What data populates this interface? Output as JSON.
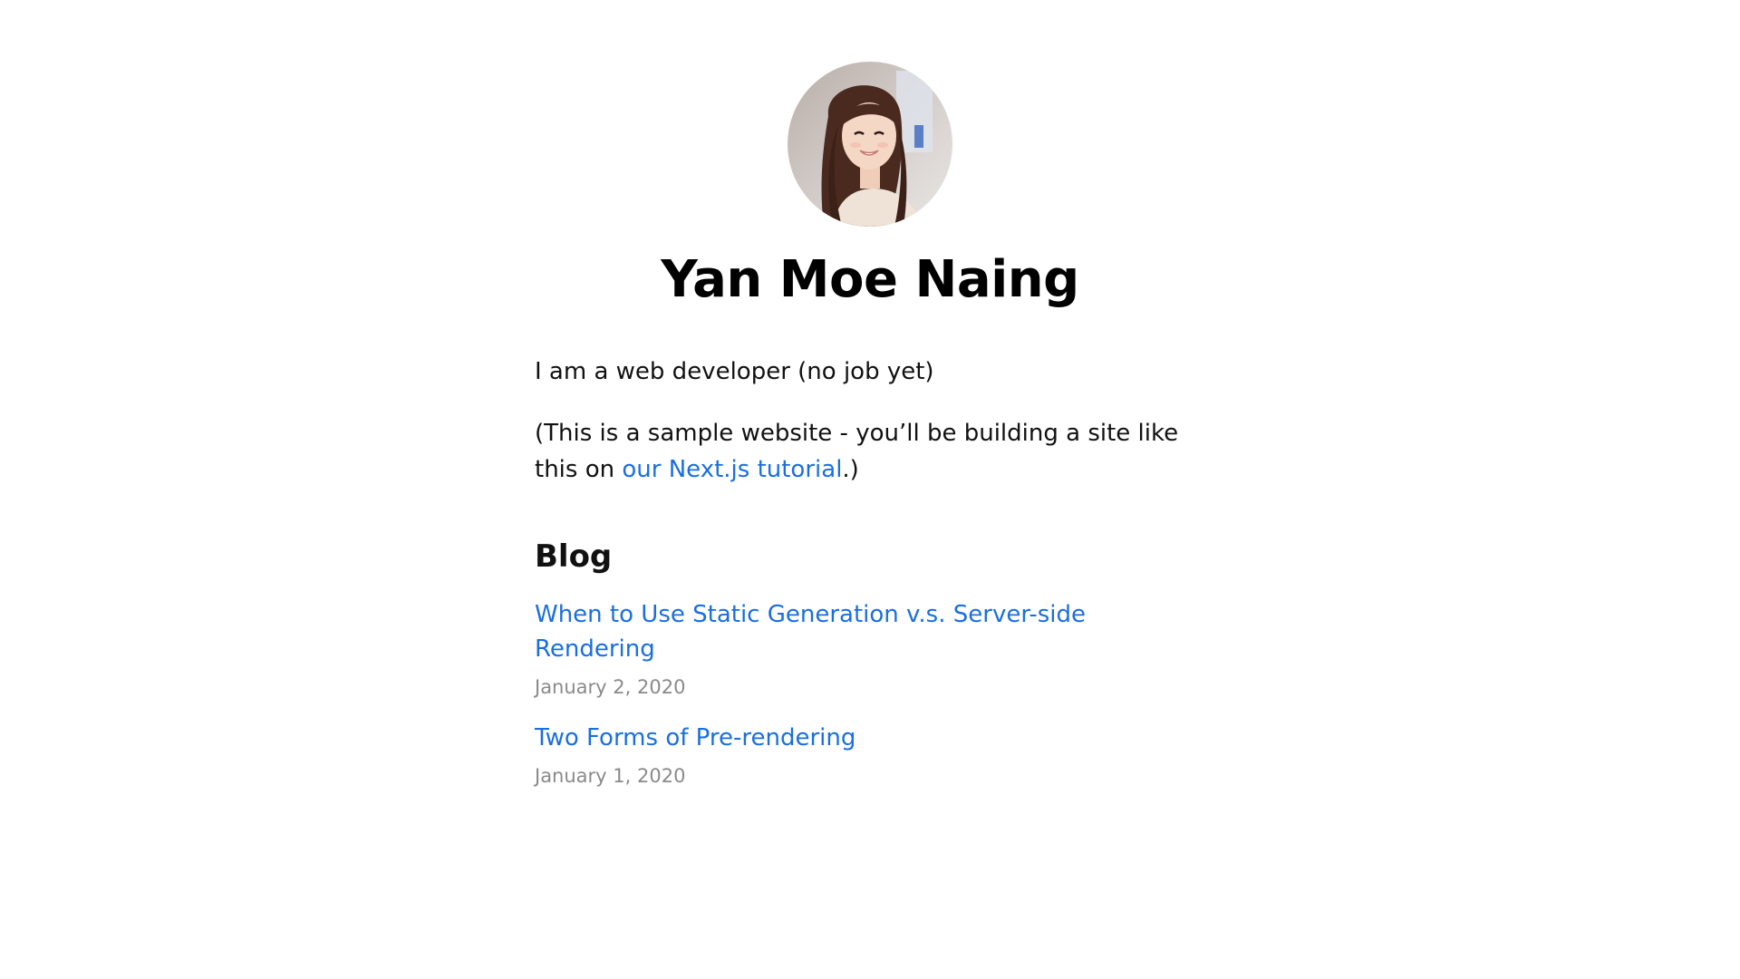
{
  "profile": {
    "name": "Yan Moe Naing",
    "avatar_icon": "profile-photo"
  },
  "bio": {
    "line1": "I am a web developer (no job yet)",
    "line2_prefix": "(This is a sample website - you’ll be building a site like this on ",
    "line2_link": "our Next.js tutorial",
    "line2_suffix": ".)"
  },
  "blog": {
    "heading": "Blog",
    "posts": [
      {
        "title": "When to Use Static Generation v.s. Server-side Rendering",
        "date": "January 2, 2020"
      },
      {
        "title": "Two Forms of Pre-rendering",
        "date": "January 1, 2020"
      }
    ]
  },
  "colors": {
    "link": "#1a6fe0",
    "date": "#8a8a8a",
    "text": "#111111"
  }
}
